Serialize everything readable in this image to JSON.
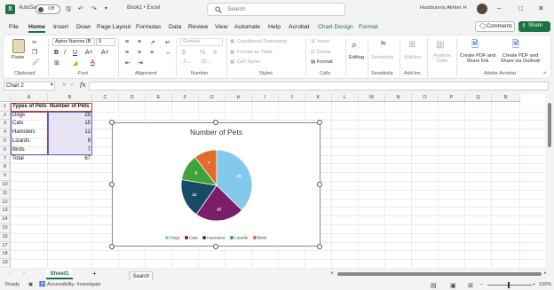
{
  "titlebar": {
    "autosave_label": "AutoSave",
    "autosave_state": "Off",
    "doc_title": "Book1 • Excel",
    "search_placeholder": "Search",
    "user_name": "Hasibunnis Akhter H"
  },
  "tabs": [
    "File",
    "Home",
    "Insert",
    "Draw",
    "Page Layout",
    "Formulas",
    "Data",
    "Review",
    "View",
    "Automate",
    "Help",
    "Acrobat",
    "Chart Design",
    "Format"
  ],
  "active_tab": "Home",
  "actions": {
    "comments": "Comments",
    "share": "Share"
  },
  "ribbon": {
    "paste": "Paste",
    "clipboard": "Clipboard",
    "font_name": "Aptos Narrow (B",
    "font_size": "9",
    "font": "Font",
    "alignment": "Alignment",
    "number_format": "General",
    "number": "Number",
    "conditional_formatting": "Conditional Formatting",
    "format_as_table": "Format as Table",
    "cell_styles": "Cell Styles",
    "styles": "Styles",
    "insert": "Insert",
    "delete": "Delete",
    "format": "Format",
    "cells": "Cells",
    "editing": "Editing",
    "sensitivity": "Sensitivity",
    "addins": "Add-ins",
    "analyze_data": "Analyze Data",
    "create_pdf_share": "Create PDF and Share link",
    "create_pdf_outlook": "Create PDF and Share via Outlook",
    "adobe_acrobat": "Adobe Acrobat"
  },
  "formula_bar": {
    "name_box": "Chart 2",
    "fx": "fx",
    "content": ""
  },
  "columns": [
    "A",
    "B",
    "C",
    "D",
    "E",
    "F",
    "G",
    "H",
    "I",
    "J",
    "K",
    "L",
    "M",
    "N",
    "O",
    "P",
    "Q",
    "R"
  ],
  "rows": [
    "1",
    "2",
    "3",
    "4",
    "5",
    "6",
    "7",
    "8",
    "9",
    "10",
    "11",
    "12",
    "13",
    "14",
    "15",
    "16",
    "17",
    "18",
    "19"
  ],
  "table": {
    "headers": [
      "Types of Pets",
      "Number of Pets"
    ],
    "rows": [
      [
        "Dogs",
        "25"
      ],
      [
        "Cats",
        "15"
      ],
      [
        "Hamsters",
        "12"
      ],
      [
        "Lizards",
        "8"
      ],
      [
        "Birds",
        "7"
      ]
    ],
    "total_label": "Total",
    "total_value": "67"
  },
  "chart_data": {
    "type": "pie",
    "title": "Number of Pets",
    "categories": [
      "Dogs",
      "Cats",
      "Hamsters",
      "Lizards",
      "Birds"
    ],
    "values": [
      25,
      15,
      12,
      8,
      7
    ],
    "colors": [
      "#83c9ea",
      "#7a1e6b",
      "#174a63",
      "#3fa33c",
      "#e36c2c"
    ],
    "legend": "bottom"
  },
  "sheets": [
    "Sheet1"
  ],
  "add_sheet": "+",
  "search_tooltip": "Search",
  "status": {
    "ready": "Ready",
    "accessibility": "Accessibility: Investigate",
    "zoom": "100%"
  }
}
